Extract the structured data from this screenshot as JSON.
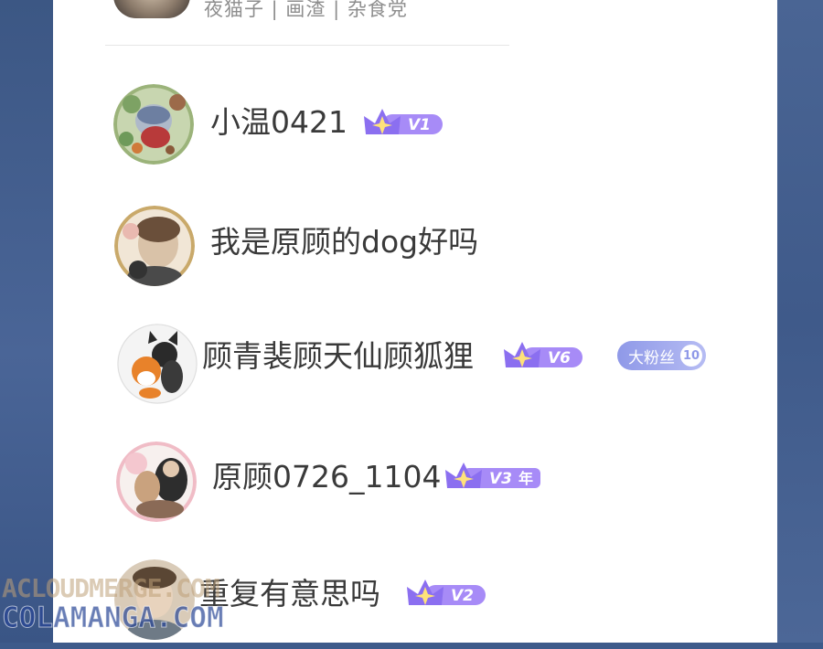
{
  "top_entry": {
    "subtitle": "夜猫子 | 画渣 | 杂食党"
  },
  "comments": [
    {
      "username": "小温0421",
      "level": "V1",
      "level_suffix": "",
      "fan_badge": null
    },
    {
      "username": "我是原顾的dog好吗",
      "level": null,
      "level_suffix": "",
      "fan_badge": null
    },
    {
      "username": "顾青裴顾天仙顾狐狸",
      "level": "V6",
      "level_suffix": "",
      "fan_badge": {
        "label": "大粉丝",
        "level": "10"
      }
    },
    {
      "username": "原顾0726_1104",
      "level": "V3",
      "level_suffix": "年",
      "fan_badge": null
    },
    {
      "username": "重复有意思吗",
      "level": "V2",
      "level_suffix": "",
      "fan_badge": null
    }
  ],
  "watermark": {
    "line1": "ACLOUDMERGE.COM",
    "line2": "COLAMANGA.COM"
  },
  "colors": {
    "background": "#3d5a8a",
    "panel": "#ffffff",
    "username": "#3a3a3a",
    "subtitle": "#8e8e8e",
    "vip_badge": "#8b6ff0",
    "fan_badge": "#8f99e8"
  }
}
